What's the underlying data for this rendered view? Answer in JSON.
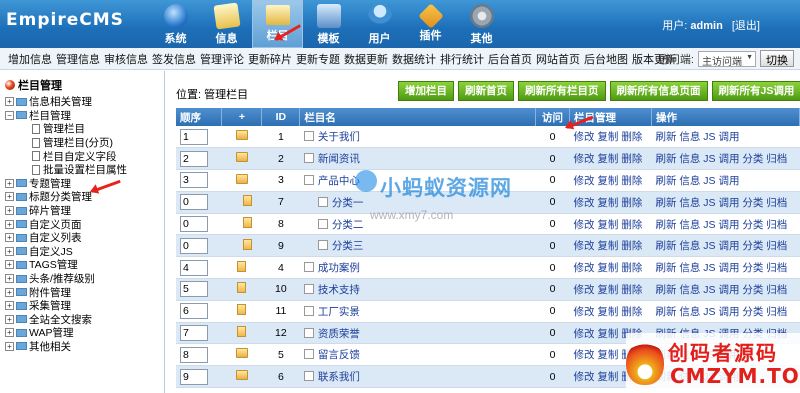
{
  "header": {
    "logo": "EmpireCMS",
    "user_label": "用户:",
    "username": "admin",
    "logout": "[退出]",
    "nav": [
      {
        "label": "系统",
        "icon": "globe-icon"
      },
      {
        "label": "信息",
        "icon": "notepad-icon"
      },
      {
        "label": "栏目",
        "icon": "folder-icon",
        "active": true
      },
      {
        "label": "模板",
        "icon": "template-icon"
      },
      {
        "label": "用户",
        "icon": "user-icon"
      },
      {
        "label": "插件",
        "icon": "plugin-icon"
      },
      {
        "label": "其他",
        "icon": "gear-icon"
      }
    ]
  },
  "menubar": {
    "items": [
      "增加信息",
      "管理信息",
      "审核信息",
      "签发信息",
      "管理评论",
      "更新碎片",
      "更新专题",
      "数据更新",
      "数据统计",
      "排行统计",
      "后台首页",
      "网站首页",
      "后台地图",
      "版本更新"
    ],
    "visitor_label": "访问端:",
    "visitor_value": "主访问端",
    "switch_label": "切换"
  },
  "sidebar": {
    "root": "栏目管理",
    "nodes": [
      {
        "label": "信息相关管理",
        "type": "plus"
      },
      {
        "label": "栏目管理",
        "type": "minus"
      },
      {
        "label": "管理栏目",
        "type": "child"
      },
      {
        "label": "管理栏目(分页)",
        "type": "child"
      },
      {
        "label": "栏目自定义字段",
        "type": "child"
      },
      {
        "label": "批量设置栏目属性",
        "type": "child"
      },
      {
        "label": "专题管理",
        "type": "plus"
      },
      {
        "label": "标题分类管理",
        "type": "plus"
      },
      {
        "label": "碎片管理",
        "type": "plus"
      },
      {
        "label": "自定义页面",
        "type": "plus"
      },
      {
        "label": "自定义列表",
        "type": "plus"
      },
      {
        "label": "自定义JS",
        "type": "plus"
      },
      {
        "label": "TAGS管理",
        "type": "plus"
      },
      {
        "label": "头条/推荐级别",
        "type": "plus"
      },
      {
        "label": "附件管理",
        "type": "plus"
      },
      {
        "label": "采集管理",
        "type": "plus"
      },
      {
        "label": "全站全文搜索",
        "type": "plus"
      },
      {
        "label": "WAP管理",
        "type": "plus"
      },
      {
        "label": "其他相关",
        "type": "plus"
      }
    ]
  },
  "content": {
    "location": "位置: 管理栏目",
    "buttons": [
      "增加栏目",
      "刷新首页",
      "刷新所有栏目页",
      "刷新所有信息页面",
      "刷新所有JS调用"
    ],
    "columns": [
      "顺序",
      "+",
      "ID",
      "栏目名",
      "访问",
      "栏目管理",
      "操作"
    ],
    "rows": [
      {
        "order": "1",
        "icon": "folder",
        "id": "1",
        "name": "关于我们",
        "visits": "0",
        "manage": "修改 复制 删除",
        "ops": "刷新 信息 JS 调用",
        "indent": false
      },
      {
        "order": "2",
        "icon": "folder",
        "id": "2",
        "name": "新闻资讯",
        "visits": "0",
        "manage": "修改 复制 删除",
        "ops": "刷新 信息 JS 调用 分类 归档",
        "indent": false
      },
      {
        "order": "3",
        "icon": "folder",
        "id": "3",
        "name": "产品中心",
        "visits": "0",
        "manage": "修改 复制 删除",
        "ops": "刷新 信息 JS 调用",
        "indent": false
      },
      {
        "order": "0",
        "icon": "file",
        "id": "7",
        "name": "分类一",
        "visits": "0",
        "manage": "修改 复制 删除",
        "ops": "刷新 信息 JS 调用 分类 归档",
        "indent": true
      },
      {
        "order": "0",
        "icon": "file",
        "id": "8",
        "name": "分类二",
        "visits": "0",
        "manage": "修改 复制 删除",
        "ops": "刷新 信息 JS 调用 分类 归档",
        "indent": true
      },
      {
        "order": "0",
        "icon": "file",
        "id": "9",
        "name": "分类三",
        "visits": "0",
        "manage": "修改 复制 删除",
        "ops": "刷新 信息 JS 调用 分类 归档",
        "indent": true
      },
      {
        "order": "4",
        "icon": "file",
        "id": "4",
        "name": "成功案例",
        "visits": "0",
        "manage": "修改 复制 删除",
        "ops": "刷新 信息 JS 调用 分类 归档",
        "indent": false
      },
      {
        "order": "5",
        "icon": "file",
        "id": "10",
        "name": "技术支持",
        "visits": "0",
        "manage": "修改 复制 删除",
        "ops": "刷新 信息 JS 调用 分类 归档",
        "indent": false
      },
      {
        "order": "6",
        "icon": "file",
        "id": "11",
        "name": "工厂实景",
        "visits": "0",
        "manage": "修改 复制 删除",
        "ops": "刷新 信息 JS 调用 分类 归档",
        "indent": false
      },
      {
        "order": "7",
        "icon": "file",
        "id": "12",
        "name": "资质荣誉",
        "visits": "0",
        "manage": "修改 复制 删除",
        "ops": "刷新 信息 JS 调用 分类 归档",
        "indent": false
      },
      {
        "order": "8",
        "icon": "folder",
        "id": "5",
        "name": "留言反馈",
        "visits": "0",
        "manage": "修改 复制 删除",
        "ops": "刷新 信息 JS 调用",
        "indent": false
      },
      {
        "order": "9",
        "icon": "folder",
        "id": "6",
        "name": "联系我们",
        "visits": "0",
        "manage": "修改 复制 删除",
        "ops": "刷新 信息 JS 调用",
        "indent": false
      }
    ]
  },
  "watermarks": {
    "site_name": "小蚂蚁资源网",
    "site_url": "www.xmy7.com",
    "brand_cn": "创码者源码",
    "brand_en": "CMZYM.TOP"
  }
}
